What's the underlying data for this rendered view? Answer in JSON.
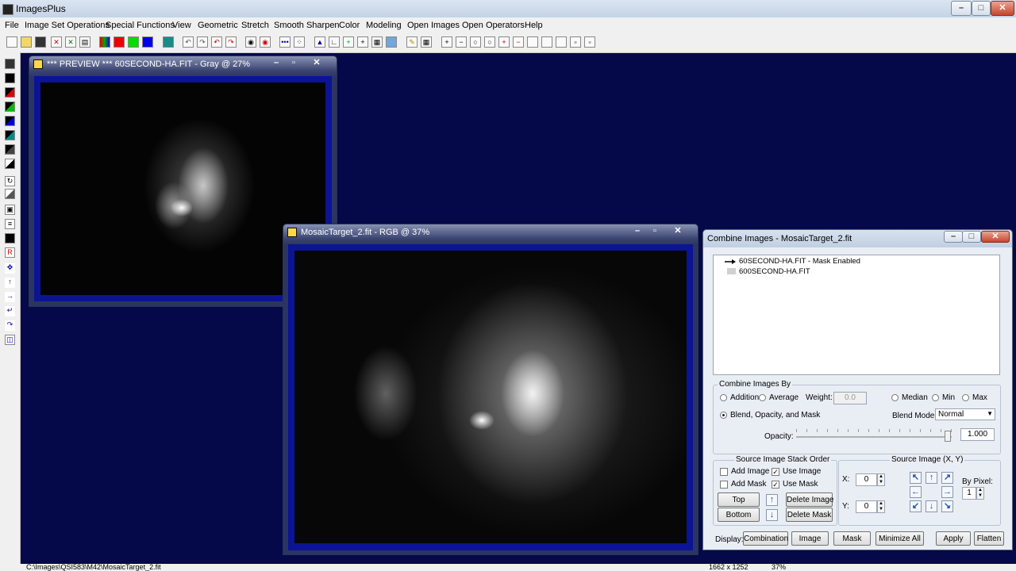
{
  "app": {
    "title": "ImagesPlus"
  },
  "menu": [
    "File",
    "Image Set Operations",
    "Special Functions",
    "View",
    "Geometric",
    "Stretch",
    "Smooth Sharpen",
    "Color",
    "Modeling",
    "Open Images",
    "Open Operators",
    "Help"
  ],
  "preview_window": {
    "title": "*** PREVIEW *** 60SECOND-HA.FIT - Gray @ 27%"
  },
  "mosaic_window": {
    "title": "MosaicTarget_2.fit - RGB @ 37%"
  },
  "combine": {
    "title": "Combine Images - MosaicTarget_2.fit",
    "tree": [
      "60SECOND-HA.FIT - Mask Enabled",
      "600SECOND-HA.FIT"
    ],
    "group_by": "Combine Images By",
    "addition": "Addition",
    "average": "Average",
    "weight_label": "Weight:",
    "weight_value": "0.0",
    "median": "Median",
    "min": "Min",
    "max": "Max",
    "blend": "Blend, Opacity, and Mask",
    "blend_mode_label": "Blend Mode:",
    "blend_mode_value": "Normal",
    "opacity_label": "Opacity:",
    "opacity_value": "1.000",
    "stack_group": "Source Image Stack Order",
    "add_image": "Add Image",
    "use_image": "Use Image",
    "add_mask": "Add Mask",
    "use_mask": "Use Mask",
    "top_btn": "Top",
    "bottom_btn": "Bottom",
    "delete_image_btn": "Delete Image",
    "delete_mask_btn": "Delete Mask",
    "xy_group": "Source Image (X, Y)",
    "x_label": "X:",
    "x_value": "0",
    "y_label": "Y:",
    "y_value": "0",
    "by_pixel_label": "By Pixel:",
    "by_pixel_value": "1",
    "display_label": "Display:",
    "combination_btn": "Combination",
    "image_btn": "Image",
    "mask_btn": "Mask",
    "minimize_all_btn": "Minimize All",
    "apply_btn": "Apply",
    "flatten_btn": "Flatten"
  },
  "status": {
    "path": "C:\\Images\\QSI583\\M42\\MosaicTarget_2.fit",
    "size": "1662 x 1252",
    "zoom": "37%"
  }
}
